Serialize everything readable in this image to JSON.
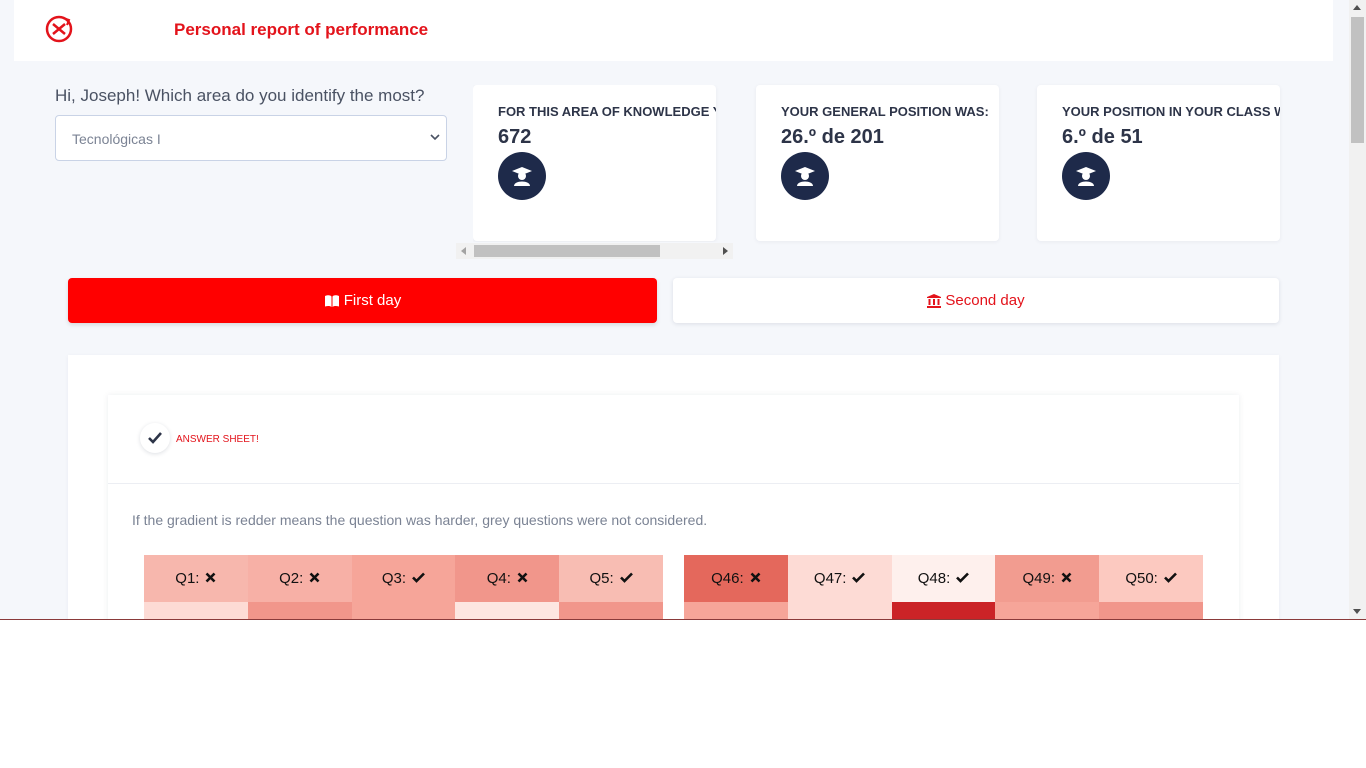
{
  "header": {
    "title": "Personal report of performance",
    "logo_icon": "logo-icon",
    "brand_color": "#e3131b"
  },
  "area_select": {
    "prompt": "Hi, Joseph! Which area do you identify the most?",
    "selected_value": "Tecnológicas I"
  },
  "cards": [
    {
      "title": "FOR THIS AREA OF KNOWLEDGE YOUR",
      "value": "672",
      "icon": "graduate-icon"
    },
    {
      "title": "YOUR GENERAL POSITION WAS:",
      "value": "26.º de 201",
      "icon": "graduate-icon"
    },
    {
      "title": "YOUR POSITION IN YOUR CLASS WAS:",
      "value": "6.º de 51",
      "icon": "graduate-icon"
    }
  ],
  "tabs": [
    {
      "label": "First day",
      "icon": "book-icon",
      "active": true
    },
    {
      "label": "Second day",
      "icon": "institution-icon",
      "active": false
    }
  ],
  "answer_sheet": {
    "title": "ANSWER SHEET!",
    "hint": "If the gradient is redder means the question was harder, grey questions were not considered."
  },
  "question_groups": [
    [
      {
        "label": "Q1:",
        "correct": false,
        "head_color": "#f7b7ad",
        "bar_color": "#fddbd5"
      },
      {
        "label": "Q2:",
        "correct": false,
        "head_color": "#f7b0a6",
        "bar_color": "#f1968b"
      },
      {
        "label": "Q3:",
        "correct": true,
        "head_color": "#f6a599",
        "bar_color": "#f6a599"
      },
      {
        "label": "Q4:",
        "correct": false,
        "head_color": "#f1968b",
        "bar_color": "#fde6e1"
      },
      {
        "label": "Q5:",
        "correct": true,
        "head_color": "#f8bdb3",
        "bar_color": "#f1968b"
      }
    ],
    [
      {
        "label": "Q46:",
        "correct": false,
        "head_color": "#e4685c",
        "bar_color": "#f6a599"
      },
      {
        "label": "Q47:",
        "correct": true,
        "head_color": "#fddbd5",
        "bar_color": "#fddbd5"
      },
      {
        "label": "Q48:",
        "correct": true,
        "head_color": "#fef0ed",
        "bar_color": "#cb2327"
      },
      {
        "label": "Q49:",
        "correct": false,
        "head_color": "#f29c90",
        "bar_color": "#f6a599"
      },
      {
        "label": "Q50:",
        "correct": true,
        "head_color": "#fcc9c0",
        "bar_color": "#f1968b"
      }
    ]
  ]
}
